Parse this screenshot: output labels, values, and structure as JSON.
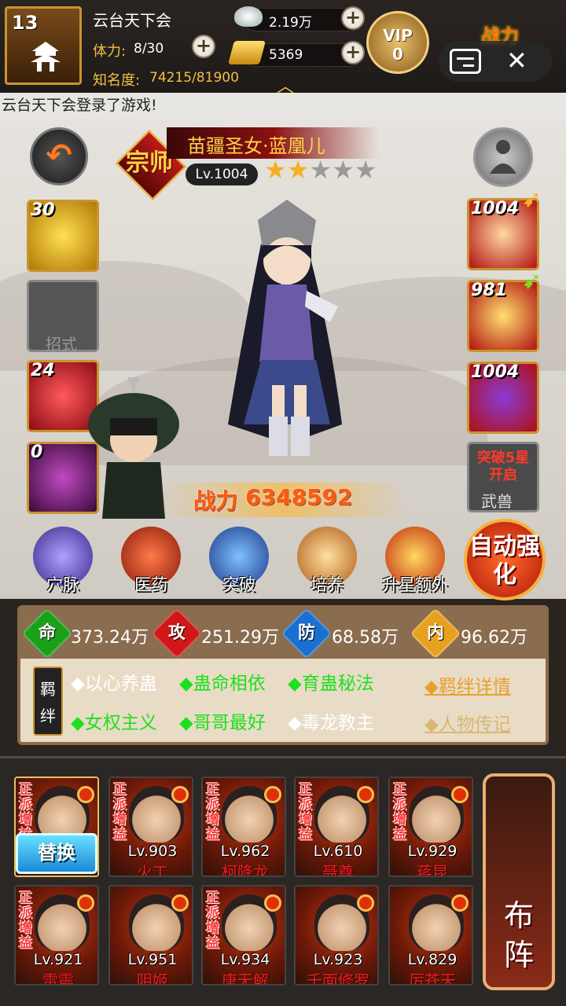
{
  "player": {
    "level": "13",
    "name": "云台天下会",
    "stamina_label": "体力:",
    "stamina_value": "8/30",
    "fame_label": "知名度:",
    "fame_value": "74215/81900"
  },
  "currency": {
    "silver": "2.19万",
    "gold": "5369"
  },
  "vip": {
    "label": "VIP",
    "level": "0"
  },
  "top_power_label": "战力",
  "notice": "云台天下会登录了游戏!",
  "hero": {
    "rank": "宗师",
    "name": "苗疆圣女·蓝凰儿",
    "level": "Lv.1004",
    "stars_filled": 2,
    "stars_total": 5,
    "power_label": "战力",
    "power_value": "6348592"
  },
  "left_slots": [
    {
      "count": "30",
      "color": "#e8b820"
    },
    {
      "label": "招式"
    },
    {
      "count": "24",
      "color": "#d81a2a"
    },
    {
      "count": "0",
      "color": "#8a2a8a"
    }
  ],
  "right_slots": [
    {
      "count": "1004"
    },
    {
      "count": "981"
    },
    {
      "count": "1004"
    }
  ],
  "breakthrough": {
    "text": "突破5星开启",
    "label": "武兽"
  },
  "menu": [
    "穴脉",
    "医药",
    "突破",
    "培养",
    "升星额外"
  ],
  "auto_button": "自动强化",
  "stats": [
    {
      "icon": "命",
      "value": "373.24万",
      "color": "#1aa01a"
    },
    {
      "icon": "攻",
      "value": "251.29万",
      "color": "#d01818"
    },
    {
      "icon": "防",
      "value": "68.58万",
      "color": "#1a70d0"
    },
    {
      "icon": "内",
      "value": "96.62万",
      "color": "#e8a020"
    }
  ],
  "bond_tag": "羁绊",
  "bonds": [
    {
      "text": "◆以心养蛊",
      "active": false
    },
    {
      "text": "◆蛊命相依",
      "active": true
    },
    {
      "text": "◆育蛊秘法",
      "active": true
    },
    {
      "text": "◆女权主义",
      "active": true
    },
    {
      "text": "◆哥哥最好",
      "active": true
    },
    {
      "text": "◆毒龙教主",
      "active": false
    }
  ],
  "links": {
    "bond_detail": "◆羁绊详情",
    "biography": "◆人物传记"
  },
  "roster_tag": "正派增益",
  "swap_button": "替换",
  "roster": [
    {
      "level": "",
      "name": ""
    },
    {
      "level": "Lv.903",
      "name": "火工"
    },
    {
      "level": "Lv.962",
      "name": "柯降龙"
    },
    {
      "level": "Lv.610",
      "name": "聂尊"
    },
    {
      "level": "Lv.929",
      "name": "蒋昆"
    },
    {
      "level": "Lv.921",
      "name": "雷震"
    },
    {
      "level": "Lv.951",
      "name": "阴姬"
    },
    {
      "level": "Lv.934",
      "name": "唐无解"
    },
    {
      "level": "Lv.923",
      "name": "千面修罗"
    },
    {
      "level": "Lv.829",
      "name": "厉苍天"
    }
  ],
  "formation_button": "布阵"
}
